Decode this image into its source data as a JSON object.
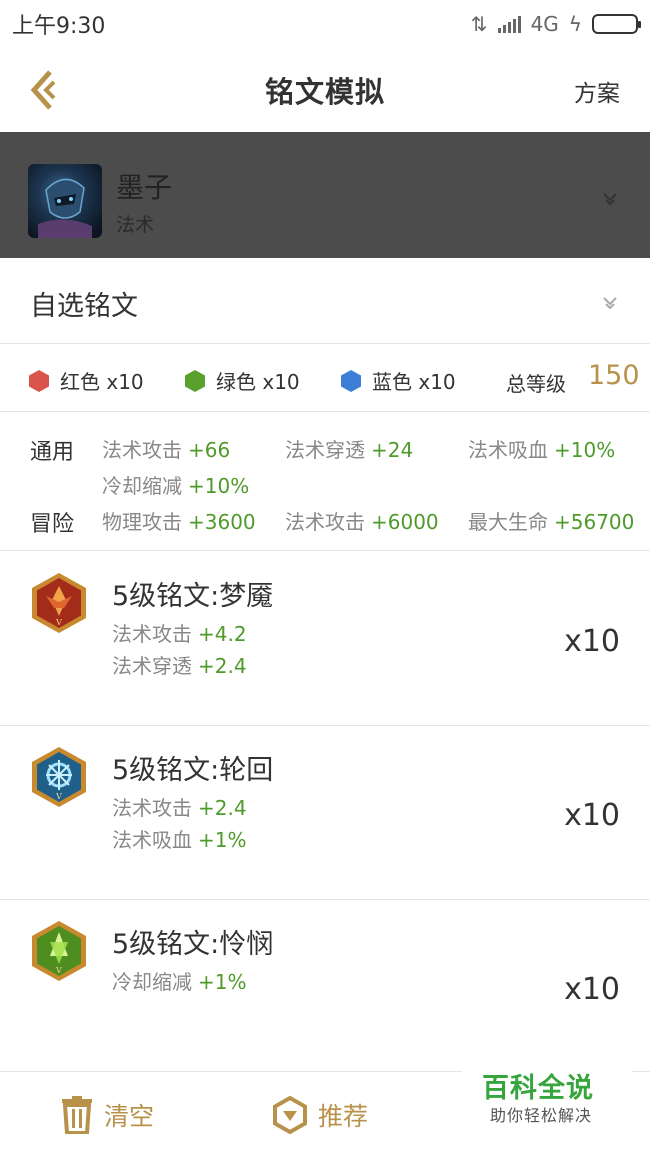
{
  "status": {
    "time": "上午9:30",
    "network": "4G"
  },
  "header": {
    "title": "铭文模拟",
    "plan_label": "方案"
  },
  "hero": {
    "name": "墨子",
    "type": "法术"
  },
  "select": {
    "label": "自选铭文"
  },
  "colors": {
    "red": {
      "label": "红色 x10",
      "color": "#d9544a"
    },
    "green": {
      "label": "绿色 x10",
      "color": "#5aa02c"
    },
    "blue": {
      "label": "蓝色 x10",
      "color": "#3d7fd6"
    },
    "total_label": "总等级",
    "total_value": "150"
  },
  "attributes": {
    "general_label": "通用",
    "general": [
      {
        "name": "法术攻击",
        "value": "+66"
      },
      {
        "name": "法术穿透",
        "value": "+24"
      },
      {
        "name": "法术吸血",
        "value": "+10%"
      },
      {
        "name": "冷却缩减",
        "value": "+10%"
      }
    ],
    "adventure_label": "冒险",
    "adventure": [
      {
        "name": "物理攻击",
        "value": "+3600"
      },
      {
        "name": "法术攻击",
        "value": "+6000"
      },
      {
        "name": "最大生命",
        "value": "+56700"
      }
    ]
  },
  "runes": [
    {
      "name": "5级铭文:梦魇",
      "icon": "red-rune-icon",
      "count": "x10",
      "stats": [
        {
          "name": "法术攻击",
          "value": "+4.2"
        },
        {
          "name": "法术穿透",
          "value": "+2.4"
        }
      ]
    },
    {
      "name": "5级铭文:轮回",
      "icon": "blue-rune-icon",
      "count": "x10",
      "stats": [
        {
          "name": "法术攻击",
          "value": "+2.4"
        },
        {
          "name": "法术吸血",
          "value": "+1%"
        }
      ]
    },
    {
      "name": "5级铭文:怜悯",
      "icon": "green-rune-icon",
      "count": "x10",
      "stats": [
        {
          "name": "冷却缩减",
          "value": "+1%"
        }
      ]
    }
  ],
  "bottom": {
    "clear_label": "清空",
    "recommend_label": "推荐"
  },
  "watermark": {
    "main": "百科全说",
    "sub": "助你轻松解决"
  },
  "accent_color": "#b8924a",
  "value_color": "#4f9a2b"
}
